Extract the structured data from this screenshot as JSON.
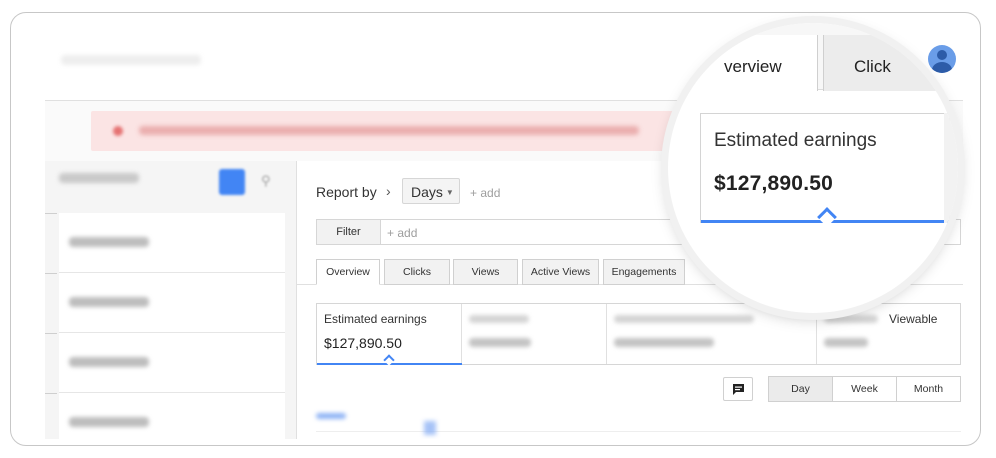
{
  "report": {
    "report_by_label": "Report by",
    "period_value": "Days",
    "add_label": "+ add"
  },
  "filter": {
    "filter_label": "Filter",
    "add_label": "+ add"
  },
  "tabs": [
    {
      "label": "Overview",
      "active": true
    },
    {
      "label": "Clicks",
      "active": false
    },
    {
      "label": "Views",
      "active": false
    },
    {
      "label": "Active Views",
      "active": false
    },
    {
      "label": "Engagements",
      "active": false
    }
  ],
  "metrics": {
    "estimated_earnings_label": "Estimated earnings",
    "estimated_earnings_value": "$127,890.50",
    "viewable_label_partial": "Viewable"
  },
  "period_buttons": [
    {
      "label": "Day",
      "selected": true
    },
    {
      "label": "Week",
      "selected": false
    },
    {
      "label": "Month",
      "selected": false
    }
  ],
  "magnifier": {
    "tab_overview_partial": "verview",
    "tab_clicks_partial": "Click",
    "card_label": "Estimated earnings",
    "card_value": "$127,890.50"
  },
  "colors": {
    "accent": "#4285f4",
    "alert_background": "#fbe4e4",
    "avatar": "#6a9de8"
  },
  "icons": {
    "comment": "comment-icon",
    "chevron": "chevron-right-icon",
    "avatar": "account-avatar-icon",
    "search": "search-icon",
    "alert": "alert-icon"
  }
}
